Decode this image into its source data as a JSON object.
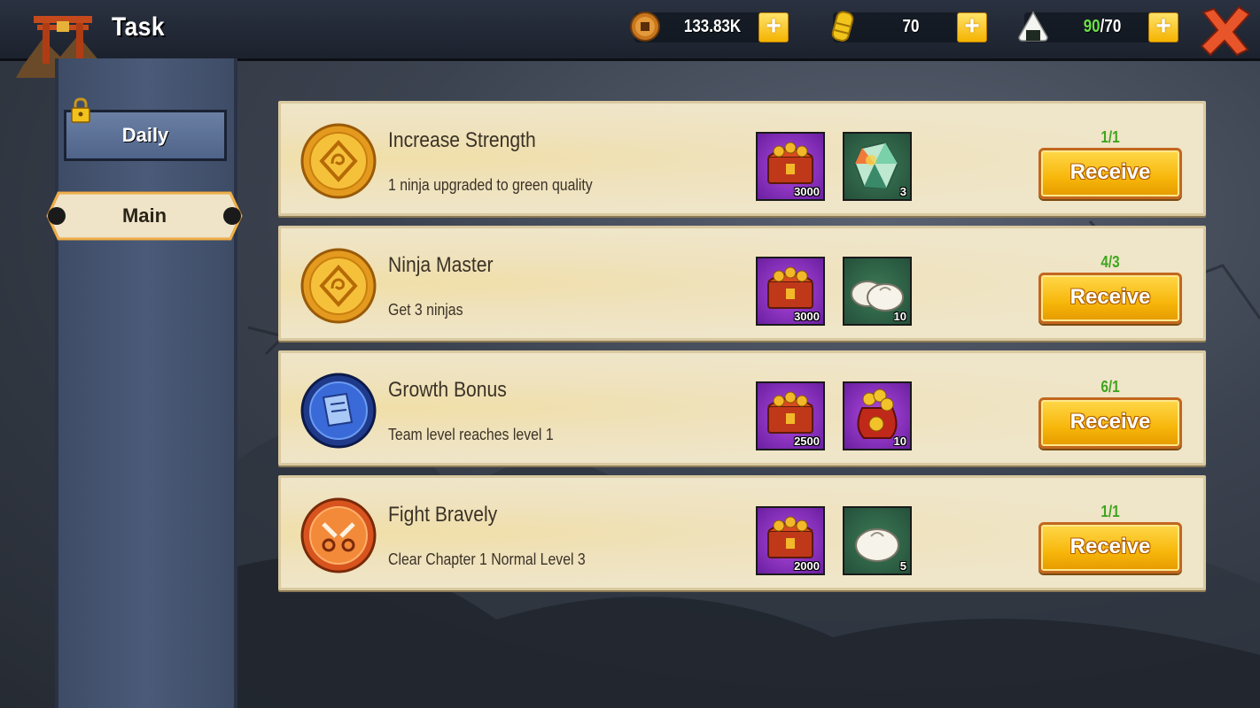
{
  "header": {
    "title": "Task",
    "coins": "133.83K",
    "gold": "70",
    "stamina_current": "90",
    "stamina_max": "/70"
  },
  "sidebar": {
    "tabs": [
      {
        "label": "Daily",
        "locked": true
      },
      {
        "label": "Main",
        "selected": true
      }
    ]
  },
  "tasks": [
    {
      "title": "Increase Strength",
      "description": "1 ninja upgraded to green quality",
      "icon": "gold-swirl-medal-icon",
      "rewards": [
        {
          "icon": "coin-chest-icon",
          "count": "3000"
        },
        {
          "icon": "crystal-gem-icon",
          "count": "3"
        }
      ],
      "progress": "1/1",
      "button": "Receive"
    },
    {
      "title": "Ninja Master",
      "description": "Get 3 ninjas",
      "icon": "gold-swirl-medal-icon",
      "rewards": [
        {
          "icon": "coin-chest-icon",
          "count": "3000"
        },
        {
          "icon": "steamed-bun-icon",
          "count": "10"
        }
      ],
      "progress": "4/3",
      "button": "Receive"
    },
    {
      "title": "Growth Bonus",
      "description": "Team level reaches level 1",
      "icon": "blue-scroll-medal-icon",
      "rewards": [
        {
          "icon": "coin-chest-icon",
          "count": "2500"
        },
        {
          "icon": "gold-bag-icon",
          "count": "10"
        }
      ],
      "progress": "6/1",
      "button": "Receive"
    },
    {
      "title": "Fight Bravely",
      "description": "Clear Chapter 1 Normal Level 3",
      "icon": "orange-blades-medal-icon",
      "rewards": [
        {
          "icon": "coin-chest-icon",
          "count": "2000"
        },
        {
          "icon": "steamed-bun-icon",
          "count": "5"
        }
      ],
      "progress": "1/1",
      "button": "Receive"
    }
  ],
  "colors": {
    "progress_green": "#3fa51f",
    "button_yellow": "#f7b60a",
    "card_bg": "#efe5c8"
  }
}
